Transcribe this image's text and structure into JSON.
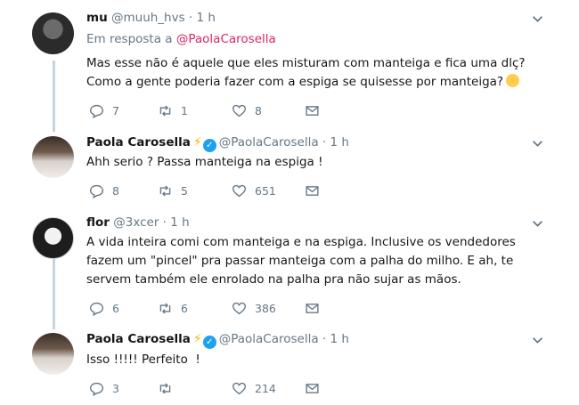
{
  "tweets": [
    {
      "name": "mu",
      "handle": "@muuh_hvs",
      "dot": "·",
      "time": "1 h",
      "reply_prefix": "Em resposta a",
      "reply_to": "@PaolaCarosella",
      "text": "Mas esse não é aquele que eles misturam com manteiga e fica uma dlç? Como a gente poderia fazer com a espiga se quisesse por manteiga?",
      "replies": "7",
      "retweets": "1",
      "likes": "8",
      "avatar_icon": "avatar-dark-hair"
    },
    {
      "name": "Paola Carosella",
      "handle": "@PaolaCarosella",
      "dot": "·",
      "time": "1 h",
      "text": "Ahh serio ? Passa manteiga na espiga !",
      "replies": "8",
      "retweets": "5",
      "likes": "651",
      "avatar_icon": "avatar-woman-white-dress"
    },
    {
      "name": "flor",
      "handle": "@3xcer",
      "dot": "·",
      "time": "1 h",
      "text": "A vida inteira comi com manteiga e na espiga. Inclusive os vendedores fazem um \"pincel\" pra passar manteiga com a palha do milho. E ah, te servem também ele enrolado na palha pra não sujar as mãos.",
      "replies": "6",
      "retweets": "6",
      "likes": "386",
      "avatar_icon": "avatar-anime-girl"
    },
    {
      "name": "Paola Carosella",
      "handle": "@PaolaCarosella",
      "dot": "·",
      "time": "1 h",
      "text": "Isso !!!!! Perfeito  !",
      "replies": "3",
      "retweets": "",
      "likes": "214",
      "avatar_icon": "avatar-woman-white-dress"
    }
  ],
  "icons": {
    "lightning": "⚡",
    "verified": "✓"
  },
  "colors": {
    "link": "#e0245e",
    "muted": "#657786",
    "verified": "#1da1f2",
    "thread_line": "#c7d3dc"
  }
}
